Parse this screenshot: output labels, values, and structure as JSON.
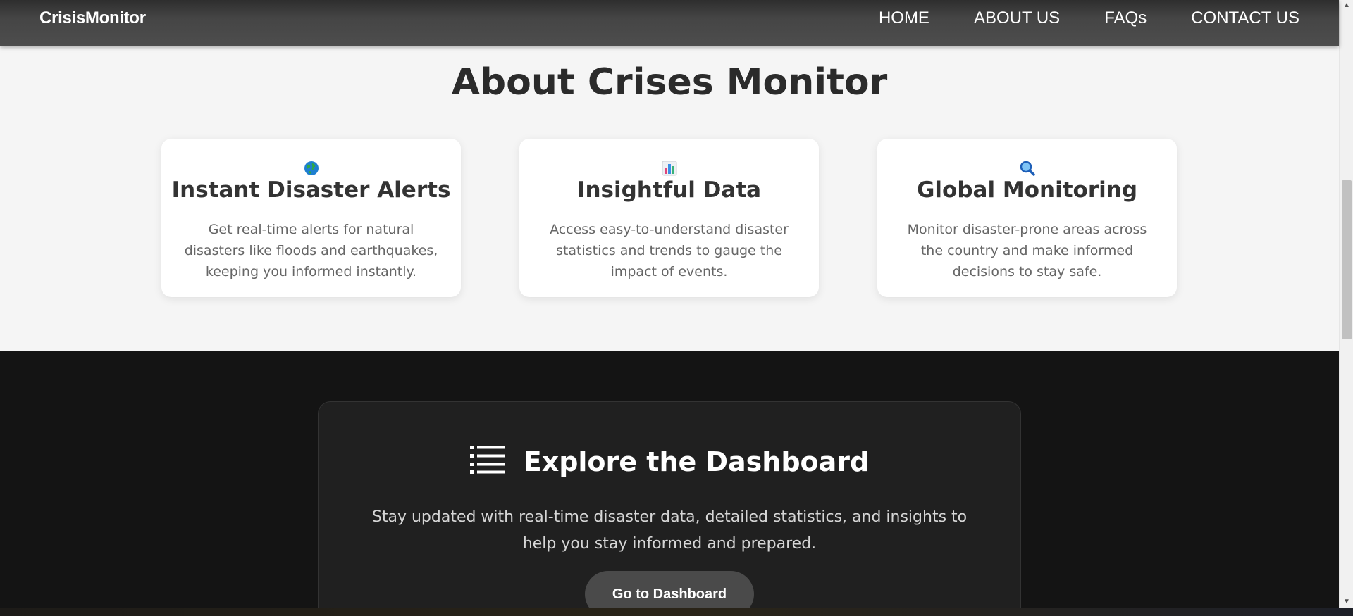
{
  "navbar": {
    "brand": "CrisisMonitor",
    "links": [
      "HOME",
      "ABOUT US",
      "FAQs",
      "CONTACT US"
    ]
  },
  "about": {
    "title": "About Crises Monitor",
    "cards": [
      {
        "icon": "globe-icon",
        "title": "Instant Disaster Alerts",
        "description": "Get real-time alerts for natural disasters like floods and earthquakes, keeping you informed instantly."
      },
      {
        "icon": "bar-chart-icon",
        "title": "Insightful Data",
        "description": "Access easy-to-understand disaster statistics and trends to gauge the impact of events."
      },
      {
        "icon": "magnifier-icon",
        "title": "Global Monitoring",
        "description": "Monitor disaster-prone areas across the country and make informed decisions to stay safe."
      }
    ]
  },
  "dashboard": {
    "icon": "list-icon",
    "title": "Explore the Dashboard",
    "description": "Stay updated with real-time disaster data, detailed statistics, and insights to help you stay informed and prepared.",
    "button_label": "Go to Dashboard"
  },
  "colors": {
    "navbar": "#4d4d4d",
    "page_background": "#f5f5f5",
    "dark_section": "#141414",
    "dashboard_card": "#202020",
    "button": "#4a4a4a"
  }
}
